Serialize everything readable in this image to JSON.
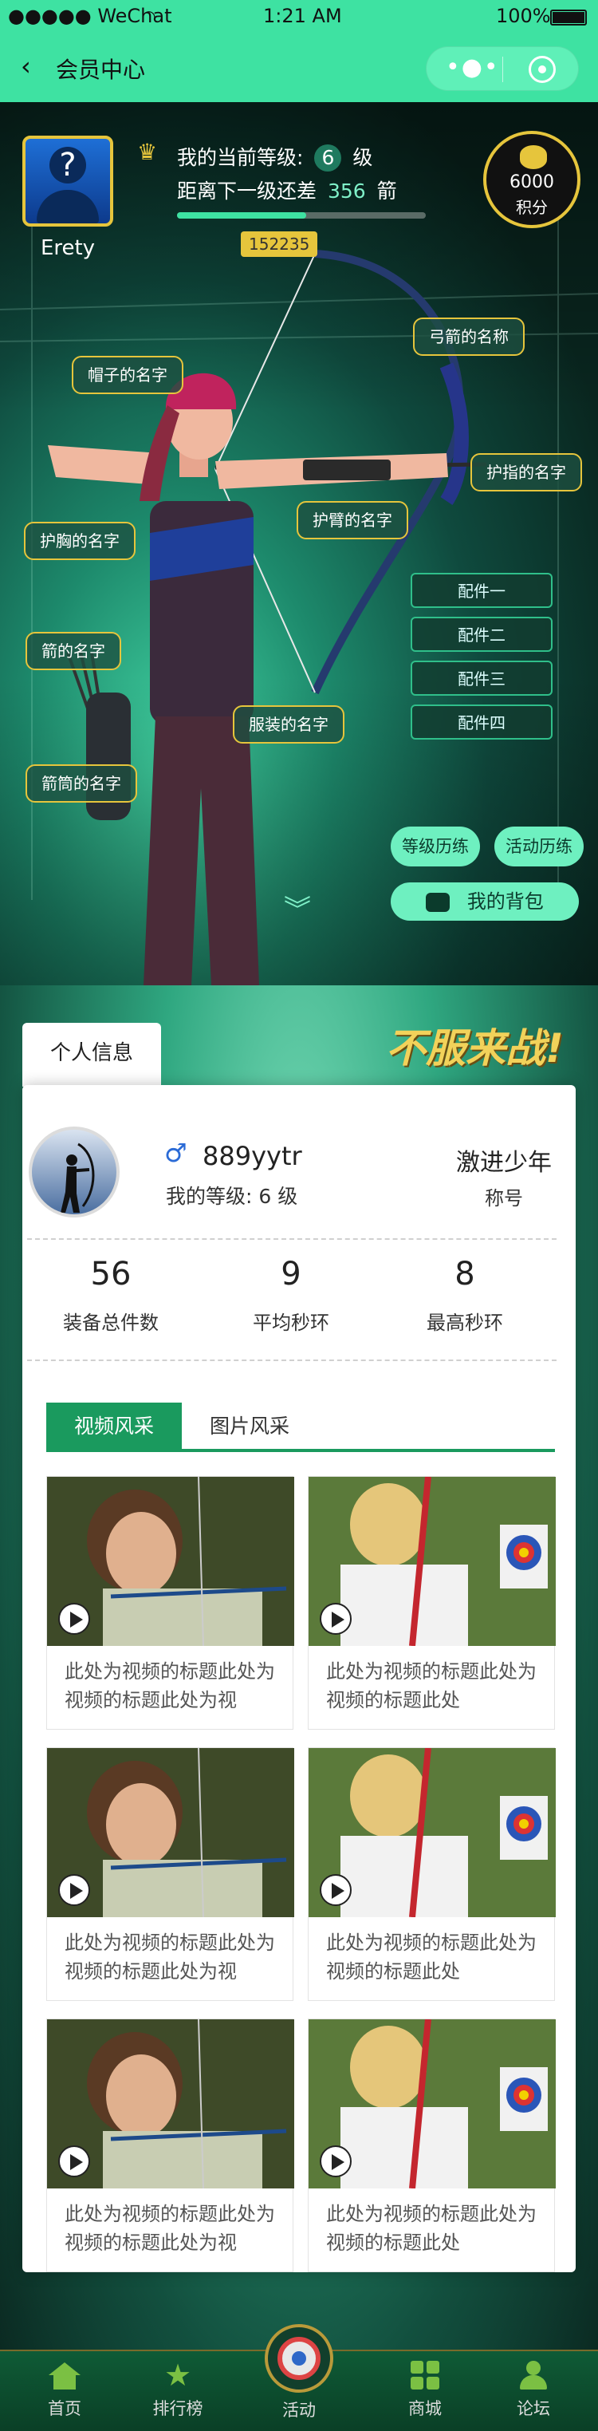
{
  "status_bar": {
    "carrier": "●●●●● WeChat",
    "time": "1:21 AM",
    "battery": "100%"
  },
  "nav": {
    "back_icon": "chevron-left",
    "title": "会员中心"
  },
  "profile": {
    "username": "Erety",
    "level_label": "我的当前等级:",
    "level": "6",
    "level_unit": "级",
    "next_label": "距离下一级还差",
    "next_value": "356",
    "next_unit": "箭",
    "progress_fraction": 0.52,
    "progress_value": "152235",
    "points_value": "6000",
    "points_label": "积分"
  },
  "equipment_labels": {
    "bow": "弓箭的名称",
    "hat": "帽子的名字",
    "finger": "护指的名字",
    "arm": "护臂的名字",
    "chest": "护胸的名字",
    "arrow": "箭的名字",
    "clothes": "服装的名字",
    "quiver": "箭筒的名字"
  },
  "accessories": [
    "配件一",
    "配件二",
    "配件三",
    "配件四"
  ],
  "actions": {
    "level_history": "等级历练",
    "activity_history": "活动历练",
    "backpack": "我的背包"
  },
  "info": {
    "tab_title": "个人信息",
    "slogan": "不服来战!",
    "user_name": "889yytr",
    "gender_icon": "male",
    "my_level_label": "我的等级:",
    "my_level": "6 级",
    "title_value": "激进少年",
    "title_label": "称号"
  },
  "stats": [
    {
      "value": "56",
      "label": "装备总件数"
    },
    {
      "value": "9",
      "label": "平均秒环"
    },
    {
      "value": "8",
      "label": "最高秒环"
    }
  ],
  "media_tabs": {
    "video": "视频风采",
    "photo": "图片风采"
  },
  "videos": [
    {
      "title": "此处为视频的标题此处为视频的标题此处为视"
    },
    {
      "title": "此处为视频的标题此处为视频的标题此处"
    },
    {
      "title": "此处为视频的标题此处为视频的标题此处为视"
    },
    {
      "title": "此处为视频的标题此处为视频的标题此处"
    },
    {
      "title": "此处为视频的标题此处为视频的标题此处为视"
    },
    {
      "title": "此处为视频的标题此处为视频的标题此处"
    }
  ],
  "tabbar": [
    {
      "label": "首页",
      "icon": "home"
    },
    {
      "label": "排行榜",
      "icon": "star"
    },
    {
      "label": "活动",
      "icon": "target"
    },
    {
      "label": "商城",
      "icon": "grid"
    },
    {
      "label": "论坛",
      "icon": "people"
    }
  ],
  "colors": {
    "accent": "#3ee2a2",
    "gold": "#e6c53c",
    "tab_green": "#1a9a5e"
  }
}
